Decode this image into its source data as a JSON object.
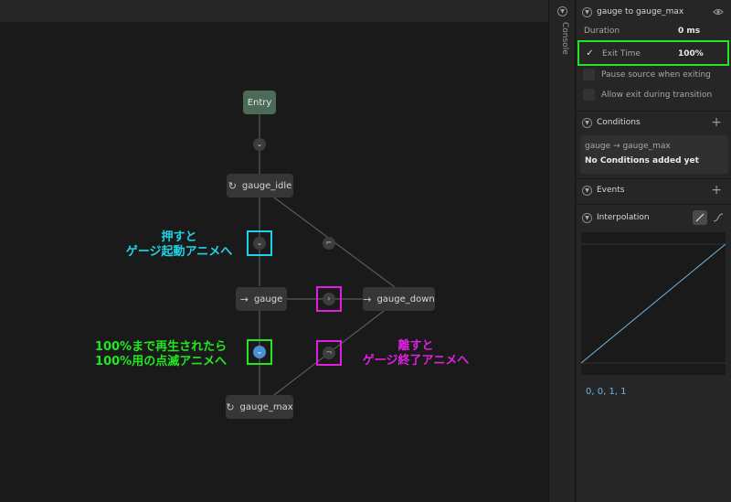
{
  "colors": {
    "state_bg": "#363636",
    "entry_bg": "#4c6a58",
    "transition_node": "#3d3d3d",
    "active_transition": "#4b8fd4",
    "highlight_cyan": "#1fd3e6",
    "highlight_green": "#22e622",
    "highlight_magenta": "#e020e0",
    "curve": "#6fb6e3"
  },
  "graph": {
    "states": {
      "entry": "Entry",
      "idle": "gauge_idle",
      "gauge": "gauge",
      "down": "gauge_down",
      "max": "gauge_max"
    },
    "icons": {
      "idle": "loop-icon",
      "gauge": "arrow-right-icon",
      "down": "arrow-right-icon",
      "max": "loop-icon"
    },
    "glyphs": {
      "loop": "↻",
      "arrow": "→"
    }
  },
  "annotations": {
    "press": {
      "line1": "押すと",
      "line2": "ゲージ起動アニメへ"
    },
    "complete": {
      "line1": "100%まで再生されたら",
      "line2": "100%用の点滅アニメへ"
    },
    "release": {
      "line1": "離すと",
      "line2": "ゲージ終了アニメへ"
    }
  },
  "console": {
    "label": "Console"
  },
  "inspector": {
    "transition_title": "gauge to gauge_max",
    "duration": {
      "label": "Duration",
      "value": "0 ms"
    },
    "exit_time": {
      "label": "Exit Time",
      "value": "100%",
      "checked": true
    },
    "pause_source": {
      "label": "Pause source when exiting",
      "checked": false
    },
    "allow_exit": {
      "label": "Allow exit during transition",
      "checked": false
    },
    "conditions": {
      "title": "Conditions",
      "transition": "gauge → gauge_max",
      "empty": "No Conditions added yet"
    },
    "events": {
      "title": "Events"
    },
    "interpolation": {
      "title": "Interpolation",
      "mode": "linear",
      "values": "0, 0, 1, 1"
    }
  }
}
